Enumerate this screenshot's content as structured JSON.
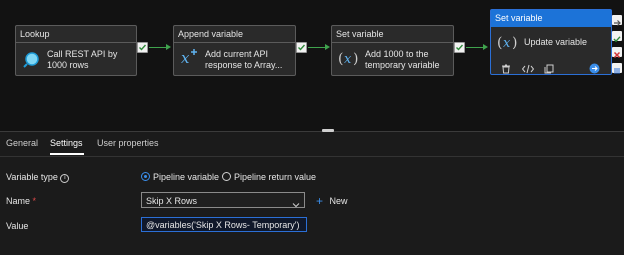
{
  "pipeline": {
    "activities": [
      {
        "type": "Lookup",
        "name": "Call REST API by 1000 rows"
      },
      {
        "type": "Append variable",
        "name": "Add current API response to Array..."
      },
      {
        "type": "Set variable",
        "name": "Add 1000 to the temporary variable"
      },
      {
        "type": "Set variable",
        "name": "Update variable",
        "selected": true
      }
    ]
  },
  "tabs": [
    {
      "label": "General"
    },
    {
      "label": "Settings",
      "active": true
    },
    {
      "label": "User properties"
    }
  ],
  "settings": {
    "variable_type_label": "Variable type",
    "variable_type_options": [
      "Pipeline variable",
      "Pipeline return value"
    ],
    "variable_type_selected": "Pipeline variable",
    "name_label": "Name",
    "name_required_mark": "*",
    "name_value": "Skip X Rows",
    "new_label": "New",
    "value_label": "Value",
    "value_value": "@variables('Skip X Rows- Temporary')"
  },
  "colors": {
    "success_connector": "#3fa34d",
    "selection_blue": "#1c73d8",
    "background": "#1b1b1b"
  }
}
